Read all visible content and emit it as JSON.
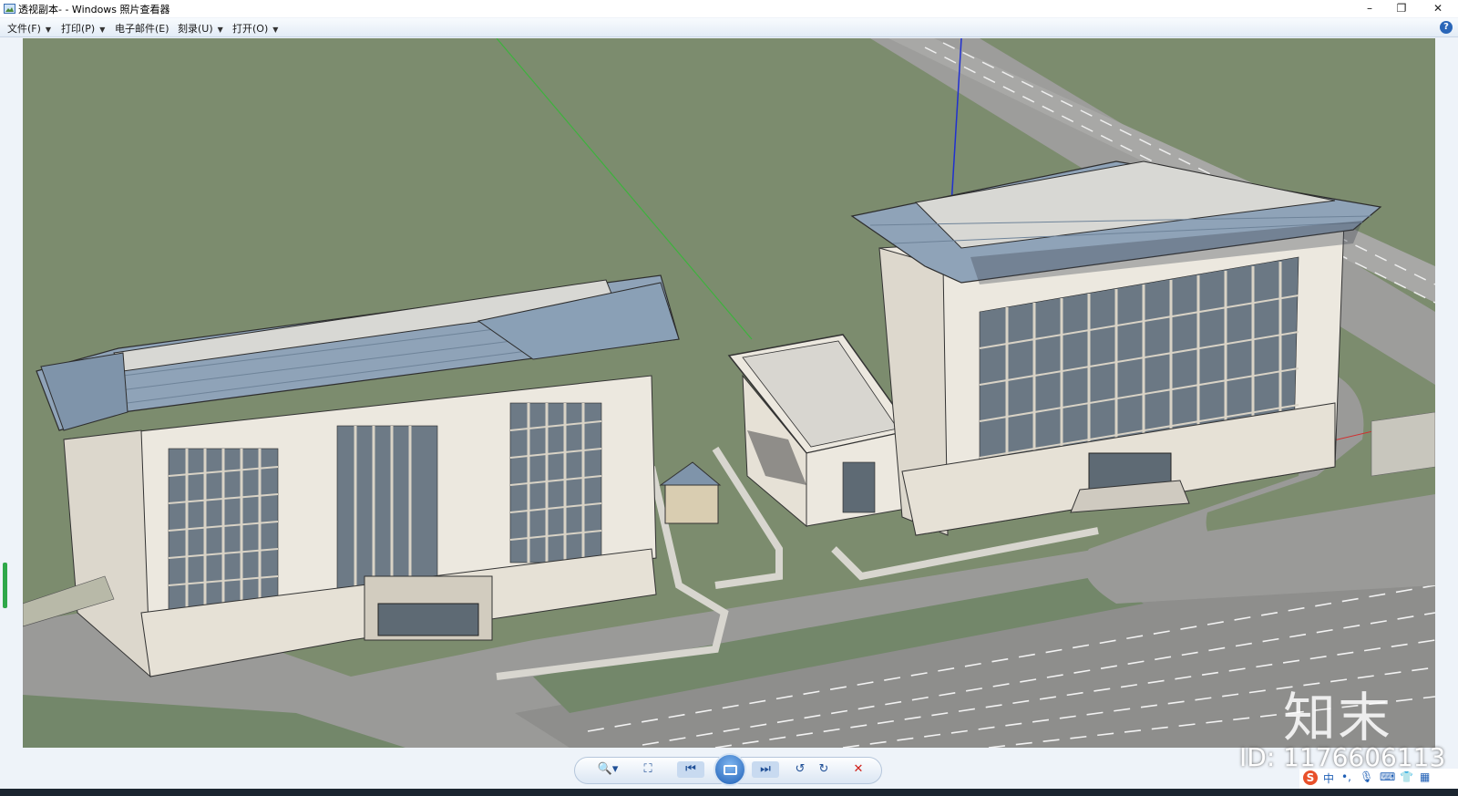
{
  "window": {
    "title": "透视副本- - Windows 照片查看器",
    "minimize": "–",
    "maximize": "❐",
    "close": "✕"
  },
  "menu": {
    "items": [
      {
        "label": "文件(F)"
      },
      {
        "label": "打印(P)"
      },
      {
        "label": "电子邮件(E)"
      },
      {
        "label": "刻录(U)"
      },
      {
        "label": "打开(O)"
      }
    ],
    "help": "?"
  },
  "controls": {
    "zoom": "🔍▾",
    "fit": "⛶",
    "previous": "⏮",
    "next": "⏭",
    "rotate_left": "↺",
    "rotate_right": "↻",
    "delete": "✕"
  },
  "watermark": {
    "logo": "知末",
    "id": "ID: 1176606113"
  },
  "tray": {
    "ime": "S",
    "lang": "中",
    "punct": "•,",
    "mic": "🎙",
    "keyboard": "⌨",
    "skin": "👕",
    "grid": "▦"
  },
  "colors": {
    "grass": "#7c8c6e",
    "road": "#9c9c9a",
    "roof": "#8fa3b8",
    "facade": "#ece8df",
    "accent": "#1f5fb5",
    "delete": "#d0201a"
  }
}
